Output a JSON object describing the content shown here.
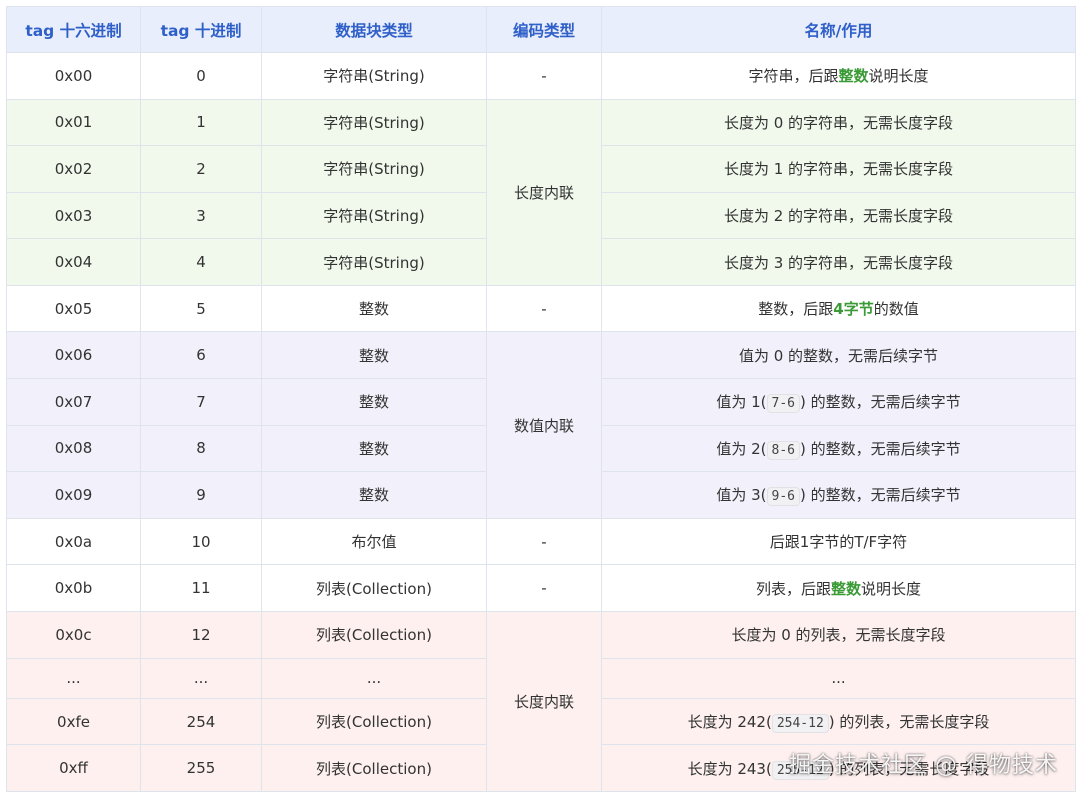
{
  "headers": [
    "tag 十六进制",
    "tag 十进制",
    "数据块类型",
    "编码类型",
    "名称/作用"
  ],
  "rows": {
    "r0": {
      "hex": "0x00",
      "dec": "0",
      "type": "字符串(String)",
      "enc": "-",
      "desc_a": "字符串，后跟",
      "desc_hl": "整数",
      "desc_b": "说明长度"
    },
    "r1": {
      "hex": "0x01",
      "dec": "1",
      "type": "字符串(String)",
      "enc": "长度内联",
      "desc": "长度为 0 的字符串，无需长度字段"
    },
    "r2": {
      "hex": "0x02",
      "dec": "2",
      "type": "字符串(String)",
      "desc": "长度为 1 的字符串，无需长度字段"
    },
    "r3": {
      "hex": "0x03",
      "dec": "3",
      "type": "字符串(String)",
      "desc": "长度为 2 的字符串，无需长度字段"
    },
    "r4": {
      "hex": "0x04",
      "dec": "4",
      "type": "字符串(String)",
      "desc": "长度为 3 的字符串，无需长度字段"
    },
    "r5": {
      "hex": "0x05",
      "dec": "5",
      "type": "整数",
      "enc": "-",
      "desc_a": "整数，后跟",
      "desc_hl": "4字节",
      "desc_b": "的数值"
    },
    "r6": {
      "hex": "0x06",
      "dec": "6",
      "type": "整数",
      "enc": "数值内联",
      "desc": "值为 0 的整数，无需后续字节"
    },
    "r7": {
      "hex": "0x07",
      "dec": "7",
      "type": "整数",
      "desc_a": "值为 1(",
      "desc_code": "7-6",
      "desc_b": ") 的整数，无需后续字节"
    },
    "r8": {
      "hex": "0x08",
      "dec": "8",
      "type": "整数",
      "desc_a": "值为 2(",
      "desc_code": "8-6",
      "desc_b": ") 的整数，无需后续字节"
    },
    "r9": {
      "hex": "0x09",
      "dec": "9",
      "type": "整数",
      "desc_a": "值为 3(",
      "desc_code": "9-6",
      "desc_b": ") 的整数，无需后续字节"
    },
    "r10": {
      "hex": "0x0a",
      "dec": "10",
      "type": "布尔值",
      "enc": "-",
      "desc": "后跟1字节的T/F字符"
    },
    "r11": {
      "hex": "0x0b",
      "dec": "11",
      "type": "列表(Collection)",
      "enc": "-",
      "desc_a": "列表，后跟",
      "desc_hl": "整数",
      "desc_b": "说明长度"
    },
    "r12": {
      "hex": "0x0c",
      "dec": "12",
      "type": "列表(Collection)",
      "enc": "长度内联",
      "desc": "长度为 0 的列表，无需长度字段"
    },
    "r13": {
      "hex": "...",
      "dec": "...",
      "type": "...",
      "desc": "..."
    },
    "r14": {
      "hex": "0xfe",
      "dec": "254",
      "type": "列表(Collection)",
      "desc_a": "长度为 242(",
      "desc_code": "254-12",
      "desc_b": ") 的列表，无需长度字段"
    },
    "r15": {
      "hex": "0xff",
      "dec": "255",
      "type": "列表(Collection)",
      "desc_a": "长度为 243(",
      "desc_code": "255-12",
      "desc_b": ") 的列表，无需长度字段"
    }
  },
  "watermark": "掘金技术社区 @ 得物技术",
  "colors": {
    "header_bg": "#e8eefc",
    "header_text": "#2f5fc8",
    "green_band": "#f1f9ec",
    "purple_band": "#f2f1fb",
    "red_band": "#fdf0ef",
    "highlight": "#3a9a35"
  }
}
